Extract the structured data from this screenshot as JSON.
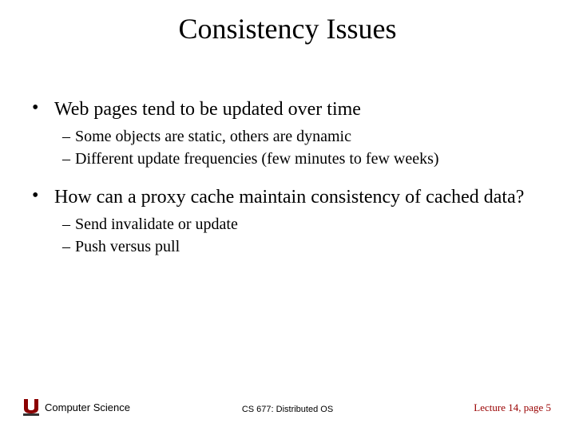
{
  "title": "Consistency Issues",
  "bullets": [
    {
      "text": "Web pages tend to be updated over time",
      "subs": [
        "Some objects are static, others are dynamic",
        "Different update frequencies (few minutes to few weeks)"
      ]
    },
    {
      "text": "How can a proxy cache maintain consistency of cached data?",
      "subs": [
        "Send invalidate or update",
        "Push versus pull"
      ]
    }
  ],
  "footer": {
    "left": "Computer Science",
    "center": "CS 677: Distributed OS",
    "right": "Lecture 14, page 5"
  }
}
